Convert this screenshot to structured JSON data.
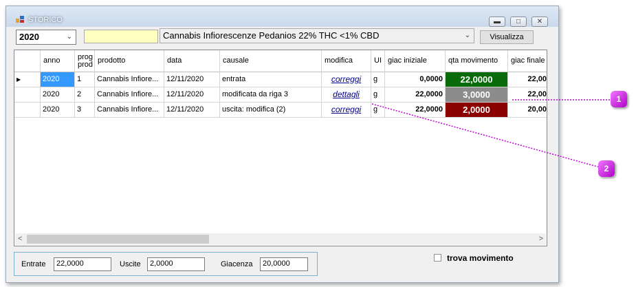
{
  "window": {
    "title": "STORICO"
  },
  "toolbar": {
    "year_value": "2020",
    "filter_value": "",
    "product_value": "Cannabis Infiorescenze Pedanios 22% THC <1% CBD",
    "show_button": "Visualizza"
  },
  "grid": {
    "columns": [
      {
        "key": "indicator",
        "label": ""
      },
      {
        "key": "anno",
        "label": "anno"
      },
      {
        "key": "prog",
        "label": "prog prod"
      },
      {
        "key": "prodotto",
        "label": "prodotto"
      },
      {
        "key": "data",
        "label": "data"
      },
      {
        "key": "causale",
        "label": "causale"
      },
      {
        "key": "modifica",
        "label": "modifica"
      },
      {
        "key": "um",
        "label": "UI"
      },
      {
        "key": "giac_iniziale",
        "label": "giac iniziale"
      },
      {
        "key": "qta",
        "label": "qta movimento"
      },
      {
        "key": "giac_finale",
        "label": "giac finale"
      }
    ],
    "rows": [
      {
        "anno": "2020",
        "prog": "1",
        "prodotto": "Cannabis Infiore...",
        "data": "12/11/2020",
        "causale": "entrata",
        "modifica": "correggi",
        "um": "g",
        "giac_iniziale": "0,0000",
        "qta": "22,0000",
        "giac_finale": "22,00",
        "qta_color": "#0a6b0a",
        "selected": true
      },
      {
        "anno": "2020",
        "prog": "2",
        "prodotto": "Cannabis Infiore...",
        "data": "12/11/2020",
        "causale": "modificata da riga 3",
        "modifica": "dettagli",
        "um": "g",
        "giac_iniziale": "22,0000",
        "qta": "3,0000",
        "giac_finale": "22,00",
        "qta_color": "#8c8c8c",
        "selected": false
      },
      {
        "anno": "2020",
        "prog": "3",
        "prodotto": "Cannabis Infiore...",
        "data": "12/11/2020",
        "causale": "uscita: modifica (2)",
        "modifica": "correggi",
        "um": "g",
        "giac_iniziale": "22,0000",
        "qta": "2,0000",
        "giac_finale": "20,00",
        "qta_color": "#8b0000",
        "selected": false
      }
    ]
  },
  "summary": {
    "entrate_label": "Entrate",
    "entrate_value": "22,0000",
    "uscite_label": "Uscite",
    "uscite_value": "2,0000",
    "giacenza_label": "Giacenza",
    "giacenza_value": "20,0000"
  },
  "find_movement_label": "trova movimento",
  "callouts": [
    "1",
    "2"
  ],
  "colors": {
    "accent": "#3399ff",
    "callout": "#c000d0"
  }
}
